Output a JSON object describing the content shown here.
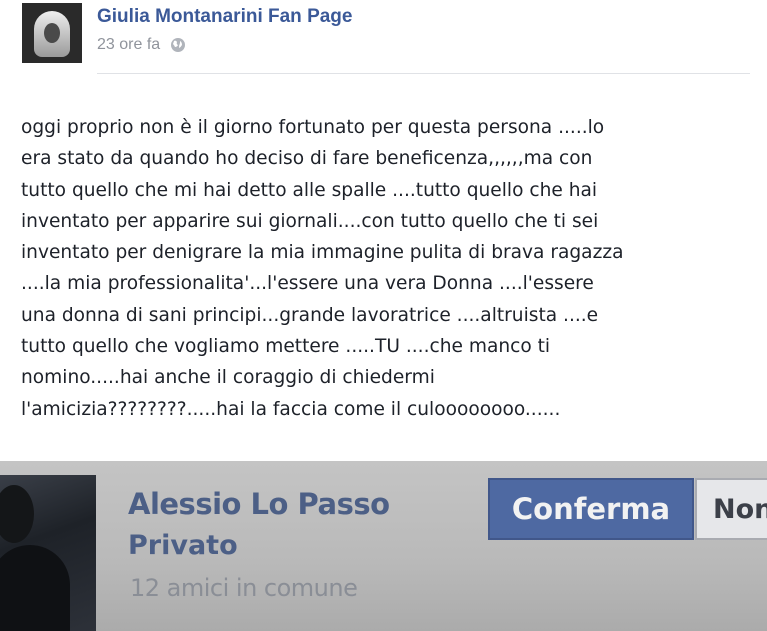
{
  "post": {
    "page_name": "Giulia Montanarini Fan Page",
    "timestamp": "23 ore fa",
    "privacy_icon": "globe-icon",
    "lines": [
      "oggi proprio non è il giorno fortunato per questa persona .....lo",
      "era stato da quando ho deciso di fare beneficenza,,,,,,ma con",
      "tutto quello che mi hai detto alle spalle ....tutto quello che hai",
      "inventato per apparire sui giornali....con tutto quello che ti sei",
      "inventato per denigrare la mia immagine pulita di brava ragazza",
      "....la mia professionalita'...l'essere una vera Donna ....l'essere",
      "una donna di sani principi...grande lavoratrice ....altruista ....e",
      "tutto quello che vogliamo mettere .....TU ....che manco ti",
      "nomino.....hai anche il coraggio di chiedermi",
      "l'amicizia????????.....hai la faccia come il culoooooooo......"
    ]
  },
  "friend_request": {
    "name": "Alessio Lo Passo",
    "status": "Privato",
    "mutual_friends": "12 amici in comune",
    "confirm_label": "Conferma",
    "reject_label": "Non"
  },
  "colors": {
    "brand_link": "#3b5998",
    "confirm_button": "#4e69a2"
  }
}
